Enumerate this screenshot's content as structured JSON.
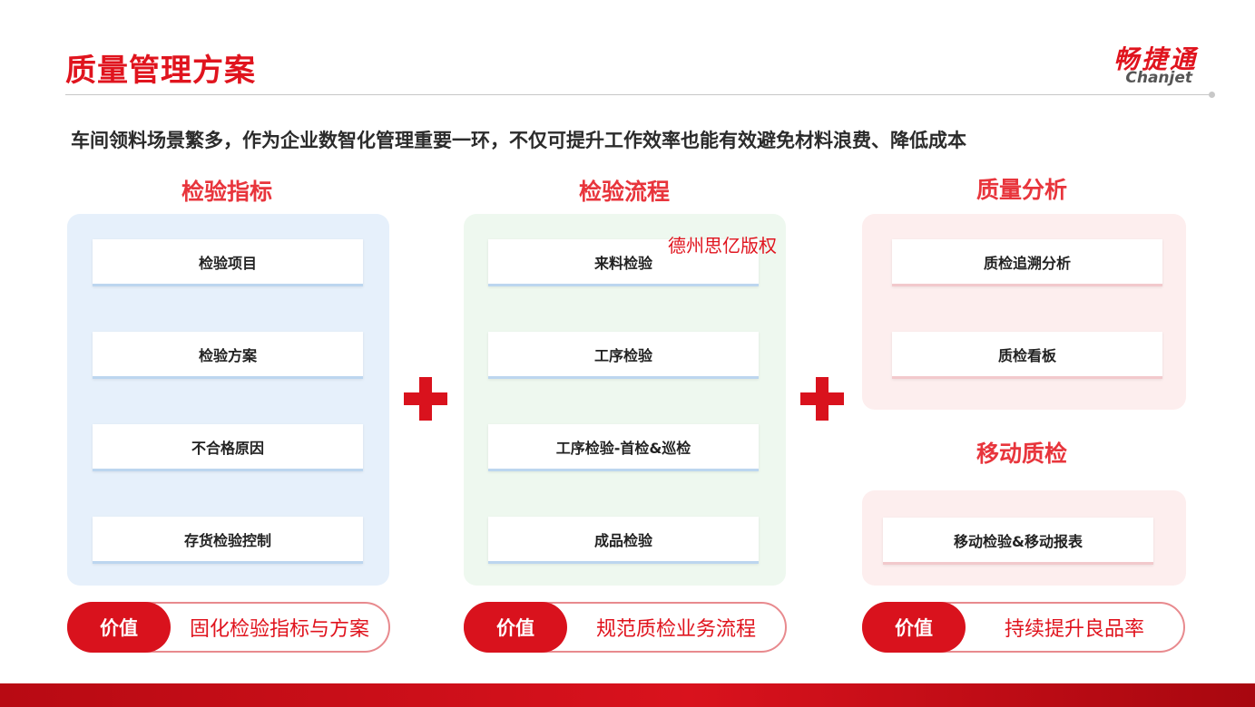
{
  "header": {
    "title": "质量管理方案",
    "logo_cn": "畅捷通",
    "logo_en": "Chanjet"
  },
  "subtitle": "车间领料场景繁多，作为企业数智化管理重要一环，不仅可提升工作效率也能有效避免材料浪费、降低成本",
  "columns": [
    {
      "heading": "检验指标",
      "items": [
        "检验项目",
        "检验方案",
        "不合格原因",
        "存货检验控制"
      ],
      "value_tag": "价值",
      "value_text": "固化检验指标与方案"
    },
    {
      "heading": "检验流程",
      "items": [
        "来料检验",
        "工序检验",
        "工序检验-首检&巡检",
        "成品检验"
      ],
      "value_tag": "价值",
      "value_text": "规范质检业务流程"
    },
    {
      "heading": "质量分析",
      "items": [
        "质检追溯分析",
        "质检看板"
      ],
      "sub_heading": "移动质检",
      "sub_items": [
        "移动检验&移动报表"
      ],
      "value_tag": "价值",
      "value_text": "持续提升良品率"
    }
  ],
  "watermark": "德州思亿版权",
  "colors": {
    "brand_red": "#e0141e",
    "panel_blue": "#e6f0fb",
    "panel_green": "#eef8ef",
    "panel_pink": "#fdeeee"
  }
}
